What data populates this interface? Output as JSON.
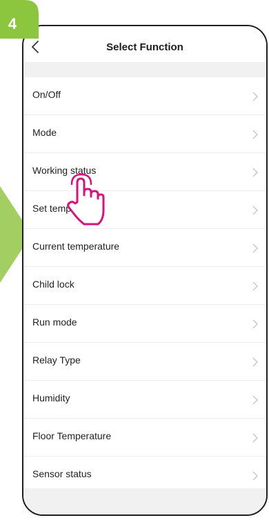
{
  "step": {
    "number": "4",
    "color": "#8cc63f"
  },
  "header": {
    "title": "Select Function",
    "back_icon": "chevron-left-icon"
  },
  "functions": [
    {
      "label": "On/Off"
    },
    {
      "label": "Mode"
    },
    {
      "label": "Working status"
    },
    {
      "label": "Set temperature"
    },
    {
      "label": "Current temperature"
    },
    {
      "label": "Child lock"
    },
    {
      "label": "Run mode"
    },
    {
      "label": "Relay Type"
    },
    {
      "label": "Humidity"
    },
    {
      "label": "Floor Temperature"
    },
    {
      "label": "Sensor status"
    }
  ],
  "colors": {
    "accent_green": "#8cc63f",
    "hand_pink": "#d6127d",
    "separator": "#ededed",
    "background_gray": "#f1f1f1"
  }
}
